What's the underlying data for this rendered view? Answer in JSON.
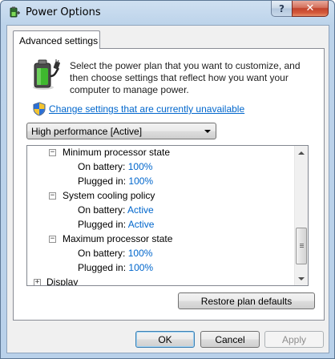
{
  "window": {
    "title": "Power Options",
    "help_label": "?",
    "close_label": "✕"
  },
  "tab": {
    "label": "Advanced settings"
  },
  "description": "Select the power plan that you want to customize, and then choose settings that reflect how you want your computer to manage power.",
  "change_link": "Change settings that are currently unavailable",
  "plan_select": {
    "value": "High performance [Active]"
  },
  "tree": {
    "min_processor": {
      "label": "Minimum processor state",
      "on_battery_label": "On battery:",
      "on_battery_value": "100%",
      "plugged_in_label": "Plugged in:",
      "plugged_in_value": "100%"
    },
    "cooling_policy": {
      "label": "System cooling policy",
      "on_battery_label": "On battery:",
      "on_battery_value": "Active",
      "plugged_in_label": "Plugged in:",
      "plugged_in_value": "Active"
    },
    "max_processor": {
      "label": "Maximum processor state",
      "on_battery_label": "On battery:",
      "on_battery_value": "100%",
      "plugged_in_label": "Plugged in:",
      "plugged_in_value": "100%"
    },
    "display": {
      "label": "Display"
    },
    "collapse_glyph": "−",
    "expand_glyph": "+"
  },
  "buttons": {
    "restore": "Restore plan defaults",
    "ok": "OK",
    "cancel": "Cancel",
    "apply": "Apply"
  },
  "icons": {
    "app": "power-options-icon",
    "battery": "battery-plug-icon",
    "shield": "uac-shield-icon"
  },
  "colors": {
    "link": "#0066cc",
    "value": "#0066cc",
    "titlebar": "#bcd3ea",
    "close": "#c2442d"
  }
}
